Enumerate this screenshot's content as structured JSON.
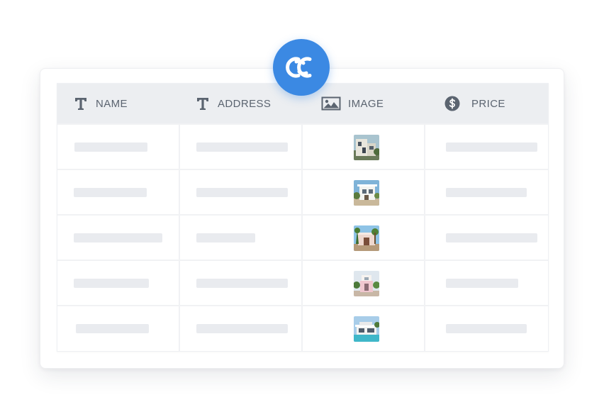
{
  "colors": {
    "accent": "#3b89e3",
    "header_bg": "#eceef1",
    "header_text": "#5b6470",
    "placeholder_bar": "#e9ebef"
  },
  "badge": {
    "icon": "link-rings-icon"
  },
  "table": {
    "columns": [
      {
        "label": "NAME",
        "icon": "text-type-icon"
      },
      {
        "label": "ADDRESS",
        "icon": "text-type-icon"
      },
      {
        "label": "IMAGE",
        "icon": "image-icon"
      },
      {
        "label": "PRICE",
        "icon": "dollar-circle-icon"
      }
    ],
    "rows": [
      {
        "image": "house-photo-1"
      },
      {
        "image": "house-photo-2"
      },
      {
        "image": "house-photo-3"
      },
      {
        "image": "house-photo-4"
      },
      {
        "image": "house-photo-5"
      }
    ]
  }
}
